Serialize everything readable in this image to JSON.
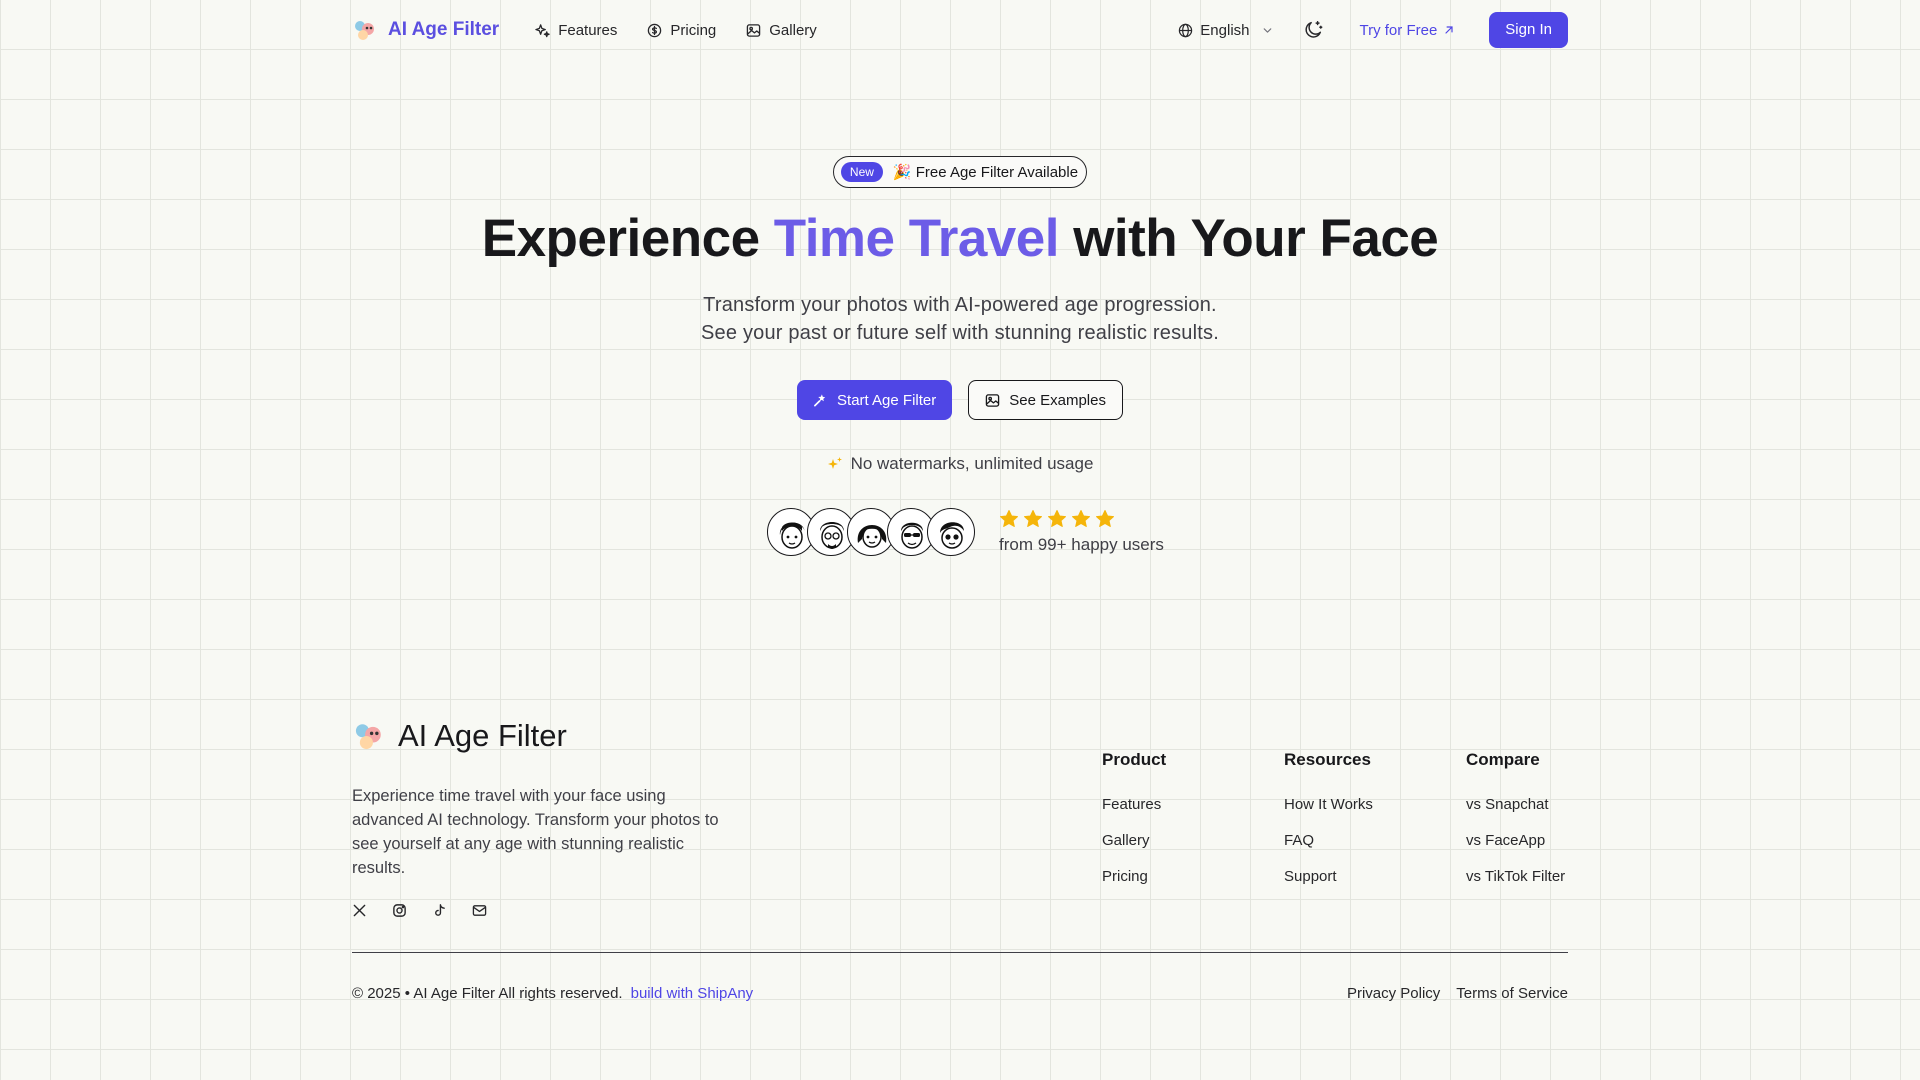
{
  "header": {
    "brand": "AI Age Filter",
    "nav": [
      {
        "label": "Features",
        "icon": "sparkles-icon"
      },
      {
        "label": "Pricing",
        "icon": "dollar-circle-icon"
      },
      {
        "label": "Gallery",
        "icon": "image-icon"
      }
    ],
    "language": "English",
    "try_free": "Try for Free",
    "sign_in": "Sign In"
  },
  "hero": {
    "badge_new": "New",
    "badge_text": "🎉 Free Age Filter Available",
    "headline_pre": "Experience ",
    "headline_accent": "Time Travel",
    "headline_post": " with Your Face",
    "subtitle_line1": "Transform your photos with AI-powered age progression.",
    "subtitle_line2": "See your past or future self with stunning realistic results.",
    "cta_primary": "Start Age Filter",
    "cta_secondary": "See Examples",
    "note": "No watermarks, unlimited usage",
    "rating_stars": 5,
    "rating_text": "from 99+ happy users"
  },
  "footer": {
    "brand": "AI Age Filter",
    "description": "Experience time travel with your face using advanced AI technology. Transform your photos to see yourself at any age with stunning realistic results.",
    "social": [
      "x-icon",
      "instagram-icon",
      "tiktok-icon",
      "mail-icon"
    ],
    "columns": [
      {
        "title": "Product",
        "links": [
          "Features",
          "Gallery",
          "Pricing"
        ]
      },
      {
        "title": "Resources",
        "links": [
          "How It Works",
          "FAQ",
          "Support"
        ]
      },
      {
        "title": "Compare",
        "links": [
          "vs Snapchat",
          "vs FaceApp",
          "vs TikTok Filter"
        ]
      }
    ],
    "copyright": "© 2025 • AI Age Filter All rights reserved.",
    "built_with": "build with ShipAny",
    "privacy": "Privacy Policy",
    "terms": "Terms of Service"
  },
  "colors": {
    "accent": "#4f46e5",
    "accent_text": "#6c5ce7",
    "star": "#f5b50a",
    "background": "#f8f9f4"
  }
}
